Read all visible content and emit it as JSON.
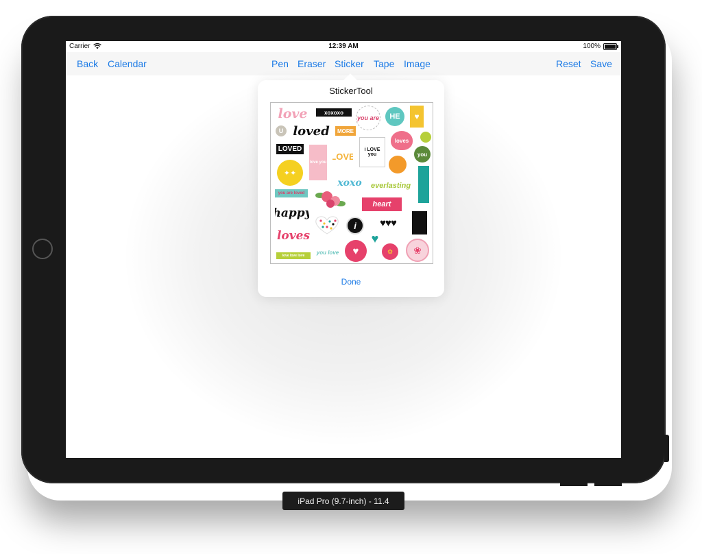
{
  "status_bar": {
    "carrier": "Carrier",
    "time": "12:39 AM",
    "battery": "100%"
  },
  "navbar": {
    "left": [
      "Back",
      "Calendar"
    ],
    "center": [
      "Pen",
      "Eraser",
      "Sticker",
      "Tape",
      "Image"
    ],
    "right": [
      "Reset",
      "Save"
    ]
  },
  "popover": {
    "title": "StickerTool",
    "done_label": "Done",
    "stickers": [
      "love",
      "xoxoxo",
      "you are",
      "HE",
      "U",
      "loved",
      "MORE",
      "LOVED",
      "love you",
      "LOVE",
      "i LOVE you",
      "loves",
      "you",
      "you are loved",
      "xoxo",
      "everlasting",
      "heart",
      "happy",
      "i",
      "loves",
      "you love",
      "love love love"
    ]
  },
  "simulator_caption": "iPad Pro (9.7-inch) - 11.4",
  "colors": {
    "accent": "#1b7ae6",
    "device": "#1a1a1a"
  }
}
